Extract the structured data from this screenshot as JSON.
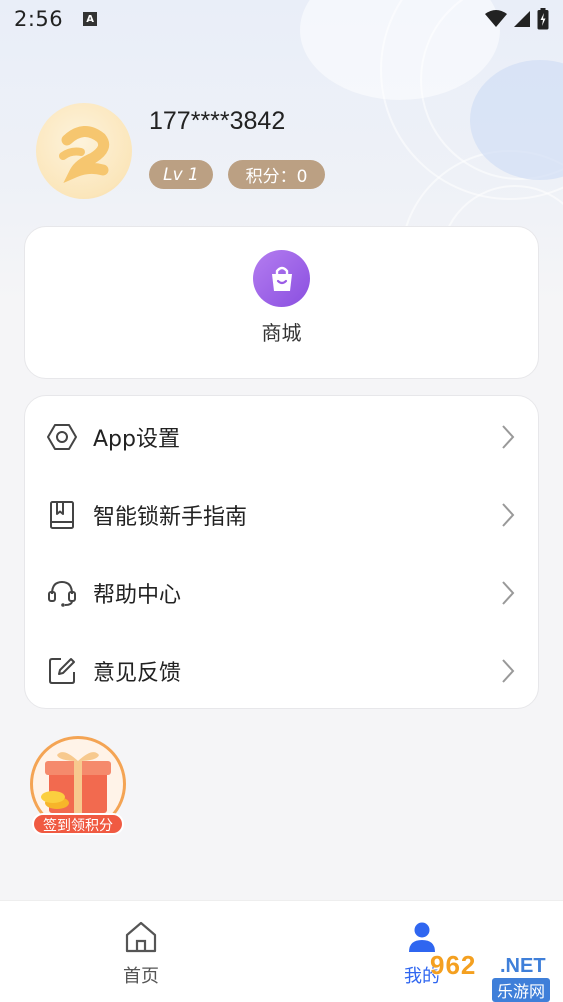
{
  "status_bar": {
    "time": "2:56",
    "notif_letter": "A"
  },
  "profile": {
    "phone": "177****3842",
    "level": "Lv 1",
    "points": "积分：0"
  },
  "shop": {
    "label": "商城"
  },
  "menu": {
    "items": [
      {
        "label": "App设置",
        "icon": "hexagon-settings-icon"
      },
      {
        "label": "智能锁新手指南",
        "icon": "book-icon"
      },
      {
        "label": "帮助中心",
        "icon": "headset-icon"
      },
      {
        "label": "意见反馈",
        "icon": "edit-icon"
      }
    ]
  },
  "checkin": {
    "label": "签到领积分"
  },
  "tabbar": {
    "home_label": "首页",
    "mine_label": "我的"
  },
  "watermark": {
    "num": "962",
    "net": ".NET",
    "sub": "乐游网"
  },
  "colors": {
    "accent": "#2f66f0",
    "badge": "#bba083",
    "shop_purple": "#8a4fe0",
    "gift_orange": "#f05a42"
  }
}
